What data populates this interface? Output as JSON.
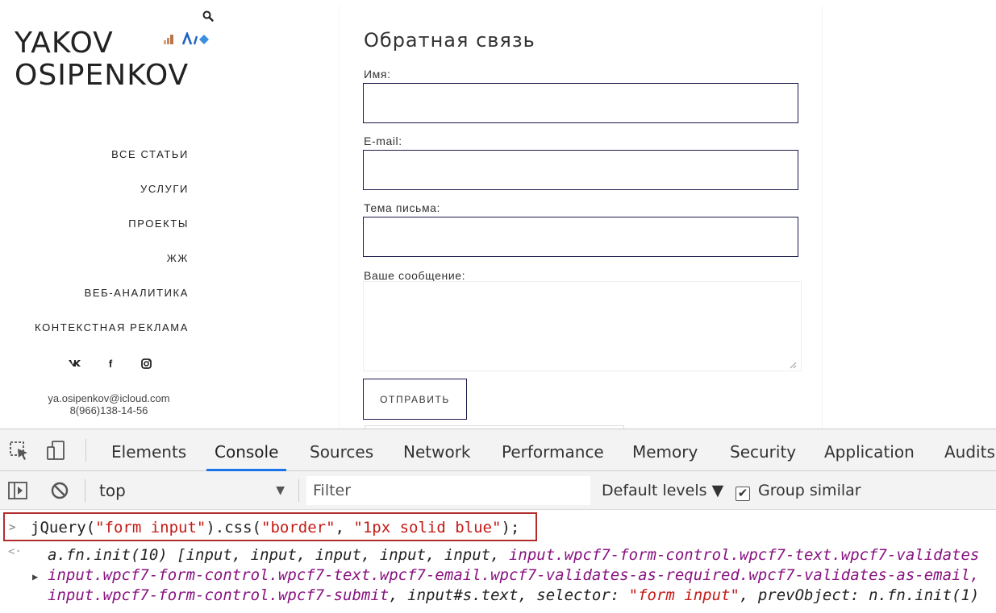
{
  "site": {
    "logo": {
      "line1": "YAKOV",
      "line2": "OSIPENKOV"
    },
    "nav": [
      {
        "label": "ВСЕ СТАТЬИ"
      },
      {
        "label": "УСЛУГИ"
      },
      {
        "label": "ПРОЕКТЫ"
      },
      {
        "label": "ЖЖ"
      },
      {
        "label": "ВЕБ-АНАЛИТИКА"
      },
      {
        "label": "КОНТЕКСТНАЯ РЕКЛАМА"
      }
    ],
    "social": {
      "vk": "ᴡᴋ",
      "facebook": "f"
    },
    "contact": {
      "email": "ya.osipenkov@icloud.com",
      "phone": "8(966)138-14-56"
    },
    "form": {
      "title": "Обратная связь",
      "name_label": "Имя:",
      "email_label": "E-mail:",
      "subject_label": "Тема письма:",
      "message_label": "Ваше сообщение:",
      "submit_label": "ОТПРАВИТЬ"
    }
  },
  "devtools": {
    "tabs": [
      "Elements",
      "Console",
      "Sources",
      "Network",
      "Performance",
      "Memory",
      "Security",
      "Application",
      "Audits"
    ],
    "active_tab": "Console",
    "context": "top",
    "filter_placeholder": "Filter",
    "levels_label": "Default levels ▼",
    "group_similar_label": "Group similar",
    "group_similar_checked": true,
    "command": {
      "prefix": "jQuery(",
      "arg1": "\"form input\"",
      "middle": ").css(",
      "arg2": "\"border\"",
      "comma": ", ",
      "arg3": "\"1px solid blue\"",
      "suffix": ");"
    },
    "output": {
      "line1_plain": "a.fn.init(10) [input, input, input, input, input, ",
      "line1_class": "input.wpcf7-form-control.wpcf7-text.wpcf7-validates",
      "line2_class": "input.wpcf7-form-control.wpcf7-text.wpcf7-email.wpcf7-validates-as-required.wpcf7-validates-as-email,",
      "line3_class": "input.wpcf7-form-control.wpcf7-submit",
      "line3_plain_a": ", input#s.text, selector: ",
      "line3_str": "\"form input\"",
      "line3_plain_b": ", prevObject: n.fn.init(1)"
    },
    "accent_color": "#1a73e8",
    "highlight_color": "#b32c2c"
  }
}
